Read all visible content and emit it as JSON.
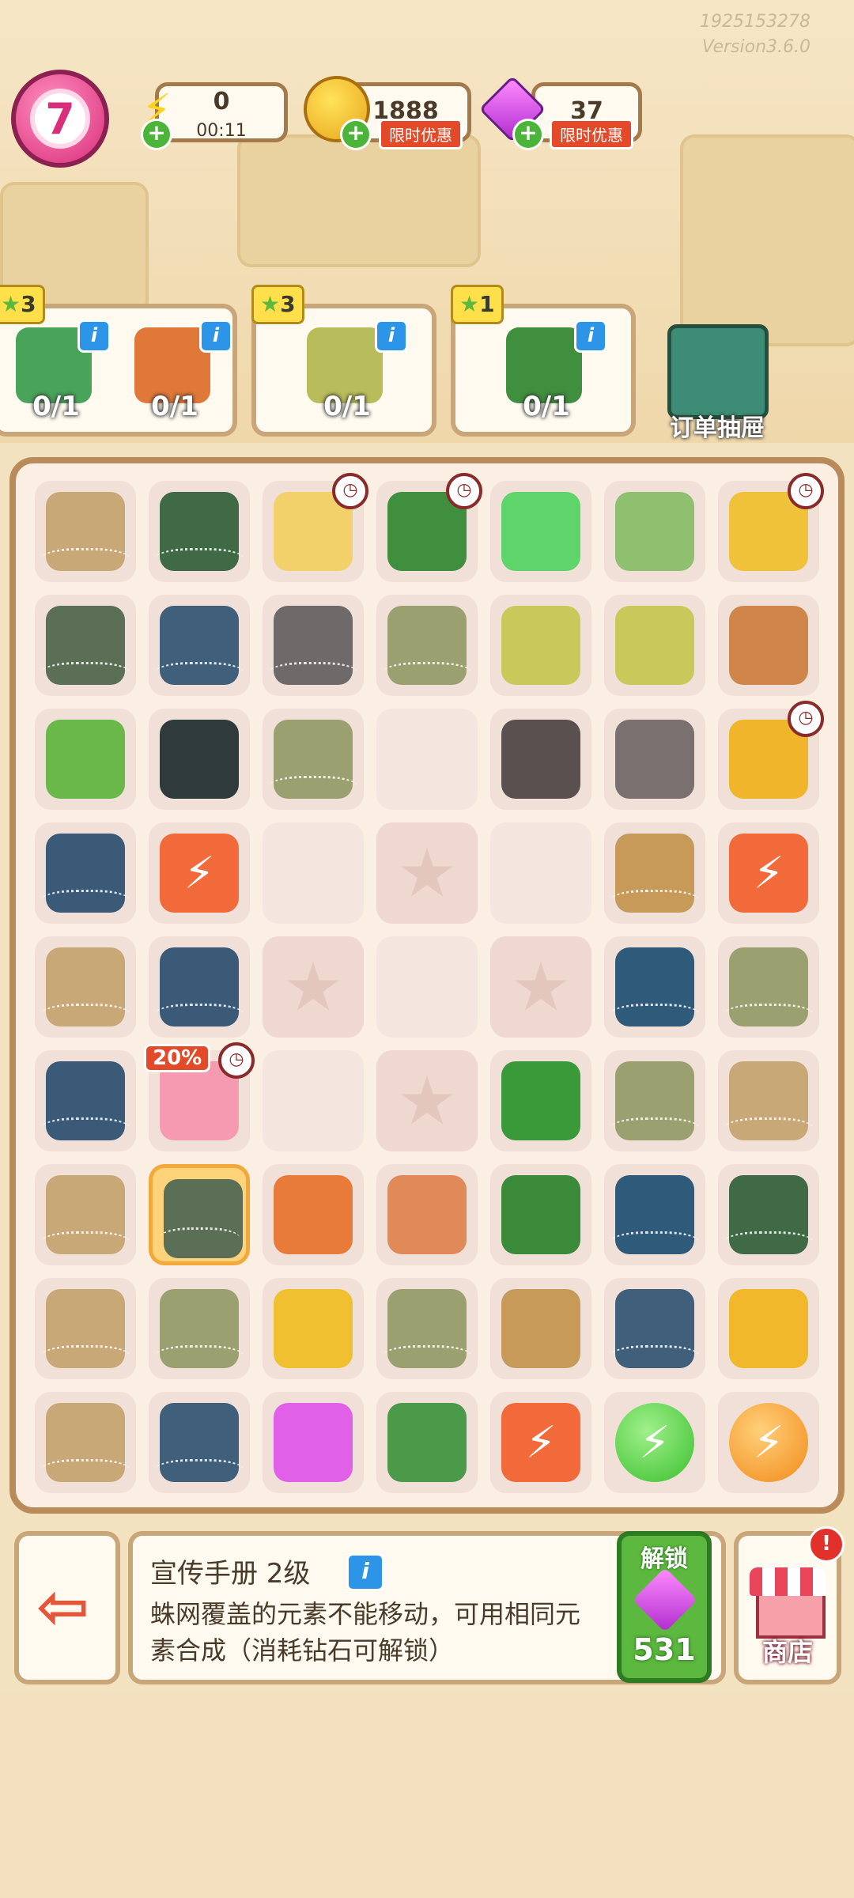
{
  "version": {
    "line1": "1925153278",
    "line2": "Version3.6.0"
  },
  "player": {
    "level": "7"
  },
  "resources": {
    "energy": {
      "value": "0",
      "timer": "00:11"
    },
    "coins": {
      "value": "1888",
      "tag": "限时优惠"
    },
    "gems": {
      "value": "37",
      "tag": "限时优惠"
    }
  },
  "orders": [
    {
      "stars": "3",
      "items": [
        {
          "name": "pruning-shears",
          "count": "0/1"
        },
        {
          "name": "pipe-cutter",
          "count": "0/1"
        }
      ]
    },
    {
      "stars": "3",
      "items": [
        {
          "name": "mushroom-seed-bag",
          "count": "0/1"
        }
      ]
    },
    {
      "stars": "1",
      "items": [
        {
          "name": "garden-loppers",
          "count": "0/1"
        }
      ]
    }
  ],
  "order_drawer": {
    "label": "订单抽屉"
  },
  "board": {
    "rows": [
      [
        "box-web",
        "toolbox-web",
        "bucket-clock",
        "crate-clock",
        "hex-gem",
        "glove",
        "cart-clock"
      ],
      [
        "manual-web",
        "chip-web",
        "sack-web",
        "tray-web",
        "seed-bag",
        "seed-pack",
        "stone"
      ],
      [
        "plant",
        "bag",
        "tray-web",
        "empty",
        "wheels",
        "wheel",
        "basket-clock"
      ],
      [
        "chips-web",
        "energy-basket",
        "empty",
        "star",
        "empty",
        "wicker-web",
        "energy-box"
      ],
      [
        "box-web",
        "chips-web",
        "star",
        "empty",
        "star",
        "board-web",
        "tray-web"
      ],
      [
        "chips-web",
        "purse-20",
        "empty",
        "star",
        "screwdriver",
        "tray-web",
        "box-web"
      ],
      [
        "box-web",
        "manual-selected",
        "trowel",
        "mallet",
        "lunchbox",
        "board-web",
        "toolbox-web"
      ],
      [
        "box-web",
        "tray-web",
        "coins",
        "tray-web",
        "wicker",
        "chip-web",
        "cabinet"
      ],
      [
        "box-web",
        "chip-web",
        "gems",
        "gift-box",
        "energy-sack",
        "energy-orb-green",
        "energy-orb-orange"
      ]
    ],
    "percent_badge": "20%"
  },
  "item_info": {
    "title": "宣传手册 2级",
    "description": "蛛网覆盖的元素不能移动，可用相同元素合成（消耗钻石可解锁）",
    "unlock_label": "解锁",
    "unlock_cost": "531"
  },
  "shop": {
    "label": "商店",
    "alert": "!"
  },
  "colors": {
    "accent_green": "#5cb83e",
    "board_border": "#b98a5a",
    "pink": "#d92e79",
    "info_blue": "#2c95e8"
  }
}
